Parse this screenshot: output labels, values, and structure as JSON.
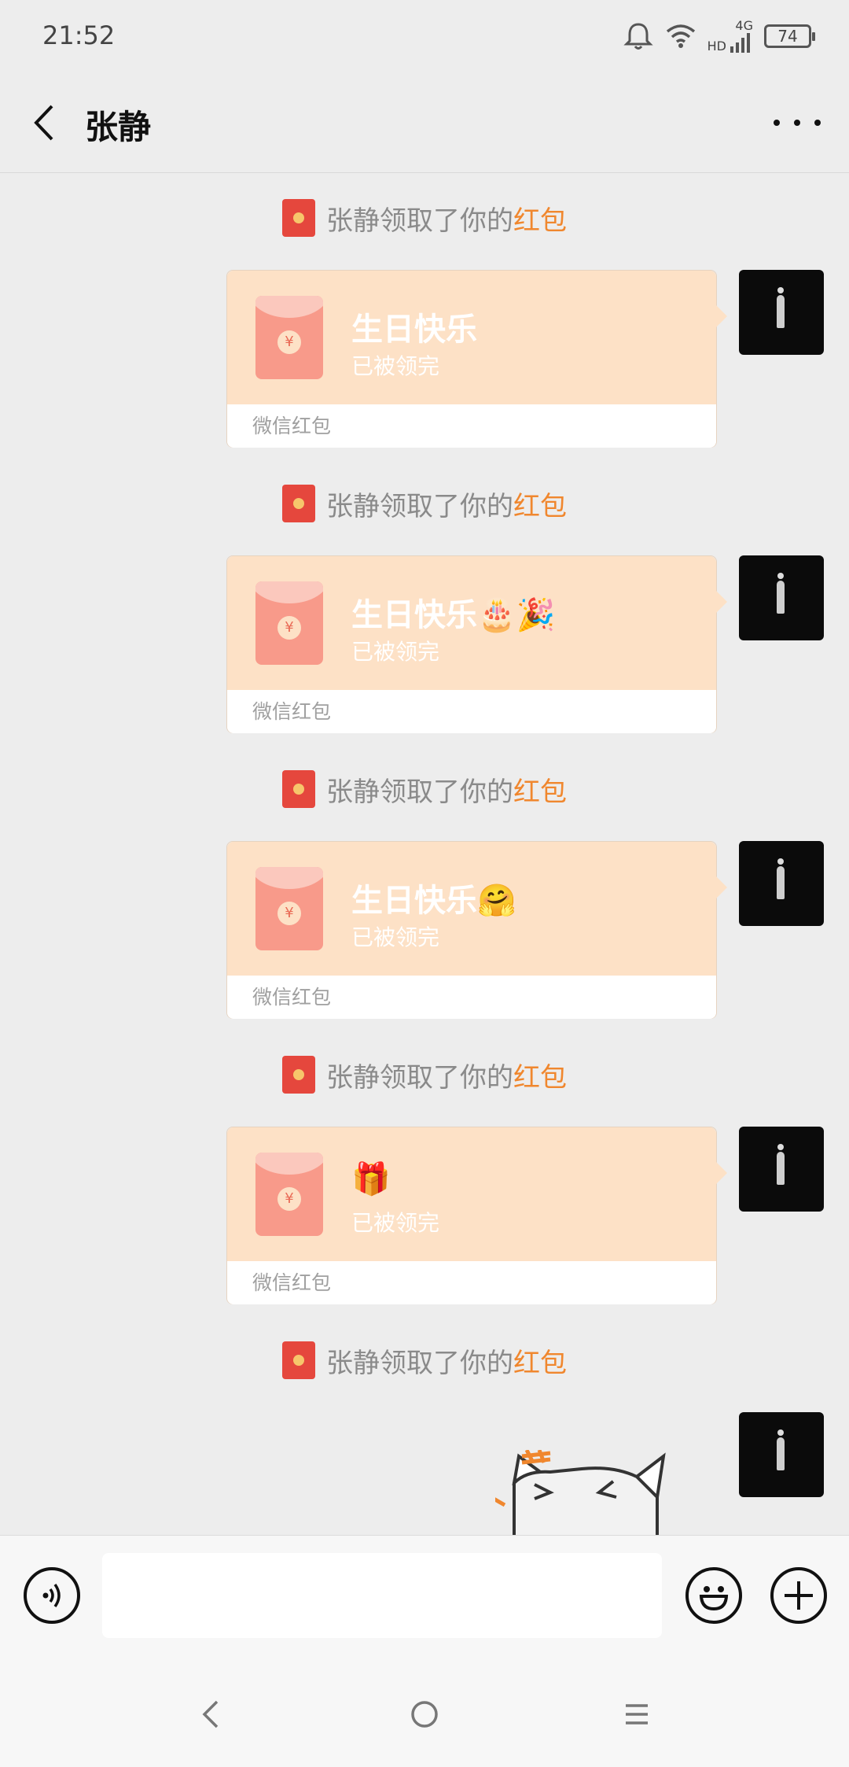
{
  "status_bar": {
    "time": "21:52",
    "battery": "74",
    "network": "4G",
    "hd": "HD"
  },
  "header": {
    "title": "张静"
  },
  "notice": {
    "prefix": "张静领取了你的",
    "highlight": "红包"
  },
  "messages": [
    {
      "title": "生日快乐",
      "emoji": "",
      "status": "已被领完",
      "footer": "微信红包"
    },
    {
      "title": "生日快乐",
      "emoji": "🎂🎉",
      "status": "已被领完",
      "footer": "微信红包"
    },
    {
      "title": "生日快乐",
      "emoji": "🤗",
      "status": "已被领完",
      "footer": "微信红包"
    },
    {
      "title": "",
      "emoji": "🎁",
      "status": "已被领完",
      "footer": "微信红包"
    }
  ],
  "input": {
    "placeholder": ""
  },
  "colors": {
    "packet_bg": "#fde1c6",
    "notice_highlight": "#f0872e",
    "mini_packet": "#e5473d"
  }
}
